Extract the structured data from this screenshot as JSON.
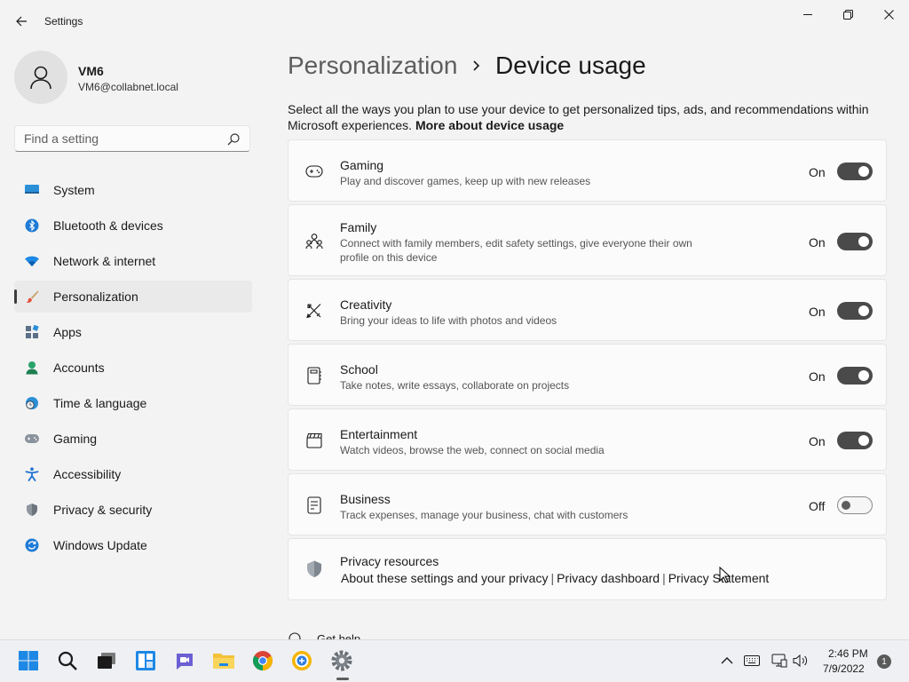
{
  "window": {
    "title": "Settings"
  },
  "user": {
    "name": "VM6",
    "email": "VM6@collabnet.local"
  },
  "search": {
    "placeholder": "Find a setting"
  },
  "nav": [
    {
      "label": "System",
      "icon": "monitor-icon"
    },
    {
      "label": "Bluetooth & devices",
      "icon": "bluetooth-icon"
    },
    {
      "label": "Network & internet",
      "icon": "wifi-icon"
    },
    {
      "label": "Personalization",
      "icon": "brush-icon",
      "active": true
    },
    {
      "label": "Apps",
      "icon": "apps-icon"
    },
    {
      "label": "Accounts",
      "icon": "person-icon"
    },
    {
      "label": "Time & language",
      "icon": "globe-clock-icon"
    },
    {
      "label": "Gaming",
      "icon": "gamepad-icon"
    },
    {
      "label": "Accessibility",
      "icon": "accessibility-icon"
    },
    {
      "label": "Privacy & security",
      "icon": "shield-icon"
    },
    {
      "label": "Windows Update",
      "icon": "update-icon"
    }
  ],
  "breadcrumb": {
    "parent": "Personalization",
    "current": "Device usage"
  },
  "description": {
    "text": "Select all the ways you plan to use your device to get personalized tips, ads, and recommendations within Microsoft experiences.",
    "link": "More about device usage"
  },
  "usages": [
    {
      "title": "Gaming",
      "desc": "Play and discover games, keep up with new releases",
      "state": "On",
      "on": true,
      "icon": "gamepad-icon"
    },
    {
      "title": "Family",
      "desc": "Connect with family members, edit safety settings, give everyone their own profile on this device",
      "state": "On",
      "on": true,
      "icon": "family-icon"
    },
    {
      "title": "Creativity",
      "desc": "Bring your ideas to life with photos and videos",
      "state": "On",
      "on": true,
      "icon": "pen-ruler-icon"
    },
    {
      "title": "School",
      "desc": "Take notes, write essays, collaborate on projects",
      "state": "On",
      "on": true,
      "icon": "notebook-icon"
    },
    {
      "title": "Entertainment",
      "desc": "Watch videos, browse the web, connect on social media",
      "state": "On",
      "on": true,
      "icon": "clapperboard-icon"
    },
    {
      "title": "Business",
      "desc": "Track expenses, manage your business, chat with customers",
      "state": "Off",
      "on": false,
      "icon": "document-icon"
    }
  ],
  "privacy": {
    "title": "Privacy resources",
    "links": [
      "About these settings and your privacy",
      "Privacy dashboard",
      "Privacy Statement"
    ],
    "separator": "|"
  },
  "get_help": "Get help",
  "taskbar": {
    "time": "2:46 PM",
    "date": "7/9/2022",
    "notifications": "1",
    "icons": [
      "start-icon",
      "search-icon",
      "task-view-icon",
      "widgets-icon",
      "chat-icon",
      "file-explorer-icon",
      "chrome-icon",
      "browser-icon",
      "settings-icon"
    ],
    "tray": [
      "chevron-up-icon",
      "keyboard-icon",
      "network-icon",
      "volume-icon"
    ]
  },
  "colors": {
    "accent": "#0067c0",
    "toggle_on": "#4a4a4a",
    "window_bg": "#f3f3f3"
  }
}
